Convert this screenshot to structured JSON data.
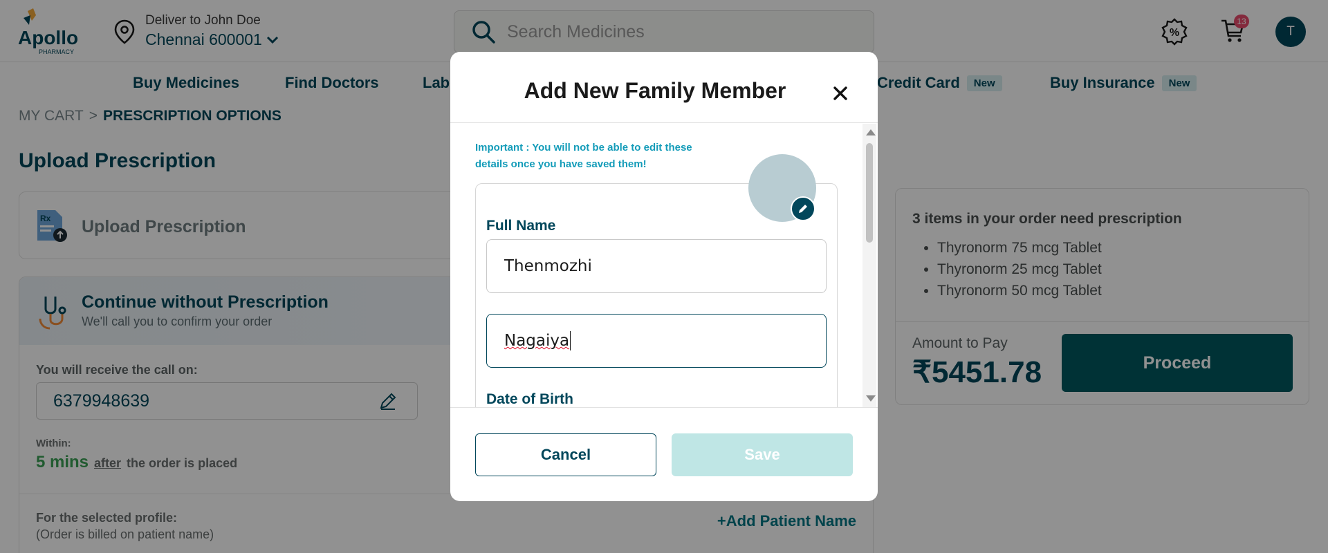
{
  "header": {
    "logo_text": "Apollo",
    "logo_subtext": "PHARMACY",
    "deliver_to": "Deliver to John Doe",
    "location": "Chennai 600001",
    "search_placeholder": "Search Medicines",
    "cart_count": "13",
    "avatar_initial": "T"
  },
  "nav": {
    "items": [
      {
        "label": "Buy Medicines"
      },
      {
        "label": "Find Doctors"
      },
      {
        "label": "Lab"
      },
      {
        "label": "Credit Card",
        "badge": "New"
      },
      {
        "label": "Buy Insurance",
        "badge": "New"
      }
    ]
  },
  "breadcrumb": {
    "cart": "MY CART",
    "separator": ">",
    "current": "PRESCRIPTION OPTIONS"
  },
  "page_title": "Upload Prescription",
  "upload_card": {
    "label": "Upload Prescription"
  },
  "continue_card": {
    "title": "Continue without Prescription",
    "subtitle": "We'll call you to confirm your order",
    "call_label": "You will receive the call on:",
    "phone": "6379948639",
    "within_label": "Within:",
    "within_time": "5 mins",
    "within_after": "after",
    "within_rest": "the order is placed",
    "profile_label": "For the selected profile:",
    "profile_note": "(Order is billed on patient name)",
    "add_patient": "+Add Patient Name"
  },
  "summary": {
    "title": "3 items in your order need prescription",
    "items": [
      "Thyronorm 75 mcg Tablet",
      "Thyronorm 25 mcg Tablet",
      "Thyronorm 50 mcg Tablet"
    ],
    "amount_label": "Amount to Pay",
    "amount_value": "₹5451.78",
    "proceed_label": "Proceed"
  },
  "modal": {
    "title": "Add New Family Member",
    "important": "Important : You will not be able to edit these details once you have saved them!",
    "full_name_label": "Full Name",
    "first_name_value": "Thenmozhi",
    "last_name_value": "Nagaiya",
    "dob_label": "Date of Birth",
    "cancel_label": "Cancel",
    "save_label": "Save"
  },
  "colors": {
    "brand": "#02475b",
    "accent_teal": "#00585f",
    "important_text": "#149cb9",
    "save_disabled": "#bfe6e5",
    "badge_red": "#e84b6c"
  },
  "icons": [
    "apollo-logo",
    "location-pin-icon",
    "search-icon",
    "offers-icon",
    "cart-icon",
    "rx-file-icon",
    "stethoscope-icon",
    "pencil-icon",
    "close-icon",
    "camera-edit-icon",
    "chevron-down-icon"
  ]
}
